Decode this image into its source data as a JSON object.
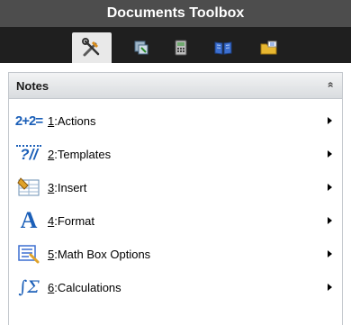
{
  "window": {
    "title": "Documents Toolbox"
  },
  "toolbar": {
    "tabs": [
      {
        "icon": "tools-icon",
        "active": true
      },
      {
        "icon": "page-sorter-icon",
        "active": false
      },
      {
        "icon": "calculator-icon",
        "active": false
      },
      {
        "icon": "book-icon",
        "active": false
      },
      {
        "icon": "folder-icon",
        "active": false
      }
    ]
  },
  "notes": {
    "title": "Notes",
    "collapse_glyph": "»",
    "items": [
      {
        "number": "1",
        "label": ":Actions",
        "icon": "actions-icon",
        "icon_text": "2+2="
      },
      {
        "number": "2",
        "label": ":Templates",
        "icon": "templates-icon",
        "icon_text": "?//"
      },
      {
        "number": "3",
        "label": ":Insert",
        "icon": "insert-icon"
      },
      {
        "number": "4",
        "label": ":Format",
        "icon": "format-icon",
        "icon_text": "A"
      },
      {
        "number": "5",
        "label": ":Math Box Options",
        "icon": "math-box-options-icon"
      },
      {
        "number": "6",
        "label": ":Calculations",
        "icon": "calculations-icon",
        "icon_text": "∫Σ"
      }
    ]
  },
  "colors": {
    "title_bar": "#4d4d4d",
    "toolbar": "#1f1f1f",
    "accent_blue": "#1b5fb8"
  }
}
